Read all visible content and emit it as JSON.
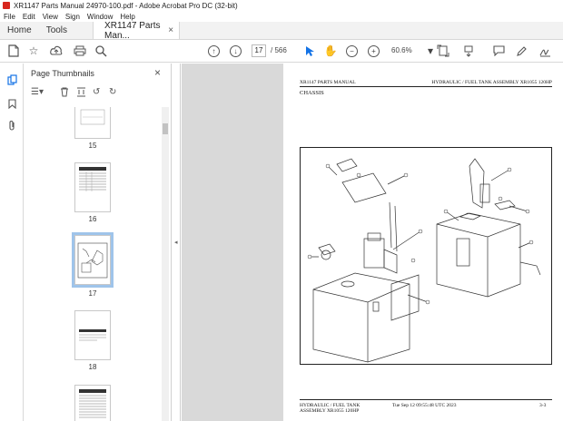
{
  "window": {
    "title": "XR1147 Parts Manual 24970-100.pdf - Adobe Acrobat Pro DC (32-bit)"
  },
  "menu": [
    "File",
    "Edit",
    "View",
    "Sign",
    "Window",
    "Help"
  ],
  "tabs": {
    "home": "Home",
    "tools": "Tools",
    "document": "XR1147 Parts Man...",
    "close": "×"
  },
  "toolbar": {
    "current_page": "17",
    "page_count": "/ 566",
    "zoom": "60.6%"
  },
  "thumbnails_panel": {
    "title": "Page Thumbnails",
    "pages": [
      {
        "label": "15"
      },
      {
        "label": "16"
      },
      {
        "label": "17",
        "selected": true
      },
      {
        "label": "18"
      },
      {
        "label": ""
      }
    ]
  },
  "document_page": {
    "header_left": "XR1147 PARTS MANUAL",
    "header_right": "HYDRAULIC / FUEL TANK ASSEMBLY XR1055 120HP",
    "section": "CHASSIS",
    "footer_left_1": "HYDRAULIC / FUEL TANK",
    "footer_left_2": "ASSEMBLY XR1055 120HP",
    "footer_center": "Tue Sep 12 09:55:48 UTC 2023",
    "footer_right": "3-3"
  },
  "colors": {
    "accent": "#1473e6",
    "app_red": "#d7261e",
    "selection": "#9fc4ea"
  }
}
